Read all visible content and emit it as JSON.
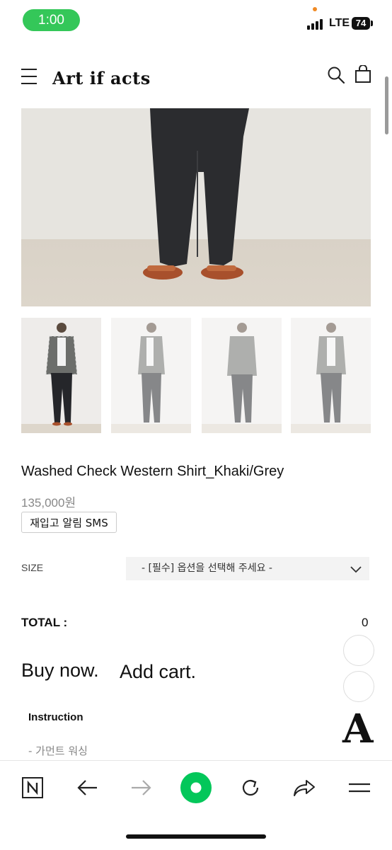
{
  "status_bar": {
    "time": "1:00",
    "network": "LTE",
    "battery": "74"
  },
  "header": {
    "brand": "Art if acts"
  },
  "product": {
    "name": "Washed Check Western Shirt_Khaki/Grey",
    "price": "135,000원",
    "restock_button": "재입고 알림 SMS"
  },
  "options": {
    "size_label": "SIZE",
    "size_placeholder": "- [필수] 옵션을 선택해 주세요 -"
  },
  "total": {
    "label": "TOTAL :",
    "value": "0"
  },
  "actions": {
    "buy_now": "Buy now.",
    "add_cart": "Add cart."
  },
  "instruction": {
    "title": "Instruction",
    "item": "- 가먼트 워싱"
  },
  "floating_logo": "A",
  "browser_toolbar": {
    "items": [
      "n-logo-icon",
      "back-arrow-icon",
      "forward-arrow-icon",
      "home-dot-icon",
      "refresh-icon",
      "share-icon",
      "menu-icon"
    ]
  },
  "colors": {
    "status_green": "#34c759",
    "toolbar_green": "#03c75a",
    "text_dark": "#111111",
    "price_grey": "#888888"
  }
}
